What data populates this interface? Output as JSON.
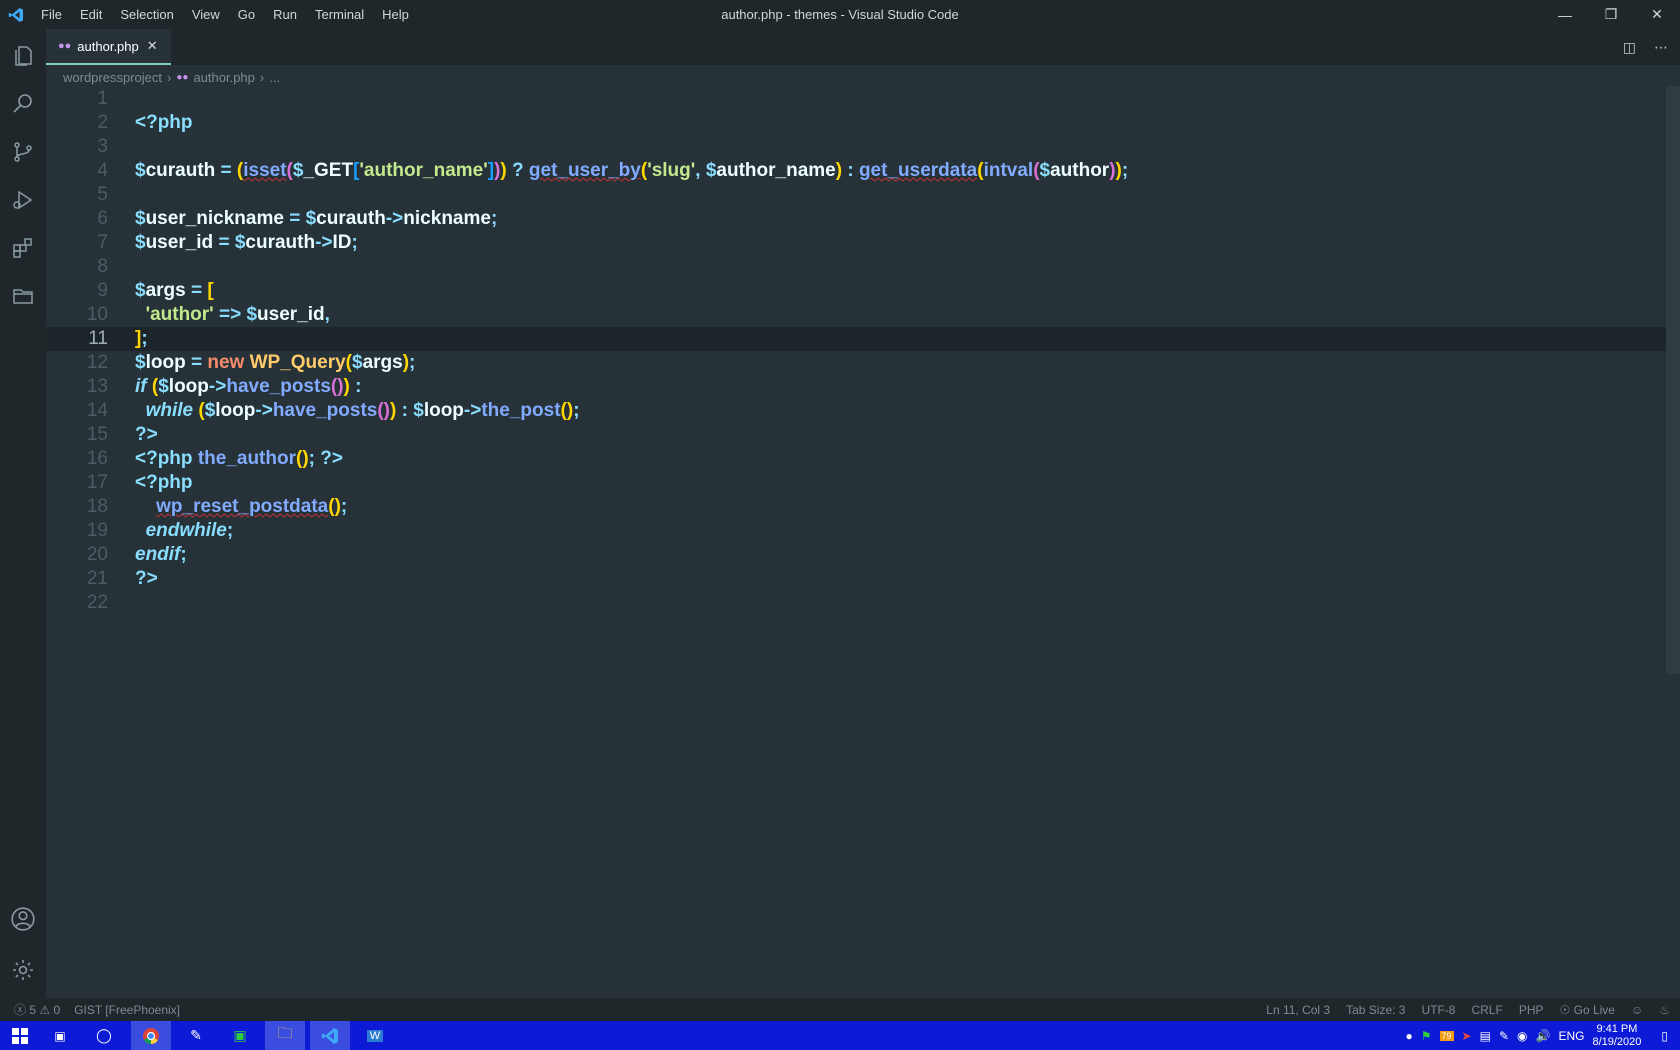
{
  "window": {
    "title": "author.php - themes - Visual Studio Code",
    "menu": [
      "File",
      "Edit",
      "Selection",
      "View",
      "Go",
      "Run",
      "Terminal",
      "Help"
    ]
  },
  "activity_bar": {
    "items": [
      "explorer-icon",
      "search-icon",
      "source-control-icon",
      "run-debug-icon",
      "extensions-icon",
      "folder-icon"
    ],
    "bottom": [
      "account-icon",
      "settings-gear-icon"
    ]
  },
  "tab": {
    "label": "author.php"
  },
  "breadcrumb": {
    "folder": "wordpressproject",
    "file": "author.php",
    "more": "..."
  },
  "editor": {
    "line_numbers": [
      "1",
      "2",
      "3",
      "4",
      "5",
      "6",
      "7",
      "8",
      "9",
      "10",
      "11",
      "12",
      "13",
      "14",
      "15",
      "16",
      "17",
      "18",
      "19",
      "20",
      "21",
      "22"
    ]
  },
  "status": {
    "errors": "5",
    "warnings": "0",
    "gist": "GIST [FreePhoenix]",
    "position": "Ln 11, Col 3",
    "tab_size": "Tab Size: 3",
    "encoding": "UTF-8",
    "eol": "CRLF",
    "language": "PHP",
    "live": "Go Live"
  },
  "taskbar": {
    "lang": "ENG",
    "time": "9:41 PM",
    "date": "8/19/2020",
    "badge": "79"
  }
}
